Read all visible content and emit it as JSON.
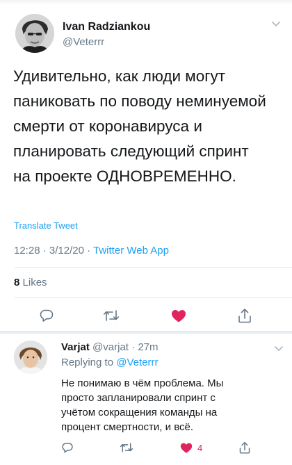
{
  "tweet": {
    "author_name": "Ivan Radziankou",
    "author_handle": "@Veterrr",
    "text_lines": [
      "Удивительно, как люди могут",
      "паниковать по поводу неминуемой",
      "смерти от коронавируса и",
      "планировать следующий спринт",
      "на проекте ОДНОВРЕМЕННО."
    ],
    "translate_label": "Translate Tweet",
    "time": "12:28",
    "date": "3/12/20",
    "dot": "·",
    "app": "Twitter Web App",
    "likes_count": "8",
    "likes_label": "Likes",
    "liked": true
  },
  "reply": {
    "author_name": "Varjat",
    "author_handle": "@varjat",
    "time_ago": "27m",
    "dot": "·",
    "replying_label": "Replying to",
    "replying_handle": "@Veterrr",
    "text_lines": [
      "Не понимаю в чём проблема. Мы",
      "просто запланировали спринт с",
      "учётом сокращения команды на",
      "процент смертности, и всё."
    ],
    "like_count": "4",
    "liked": true
  },
  "icons": {
    "more": "chevron-down-icon",
    "reply": "reply-icon",
    "retweet": "retweet-icon",
    "like": "heart-icon",
    "share": "share-icon"
  },
  "colors": {
    "accent": "#1da1f2",
    "like": "#e0245e",
    "muted": "#657786",
    "text": "#14171a",
    "divider": "#e6ecf0"
  }
}
